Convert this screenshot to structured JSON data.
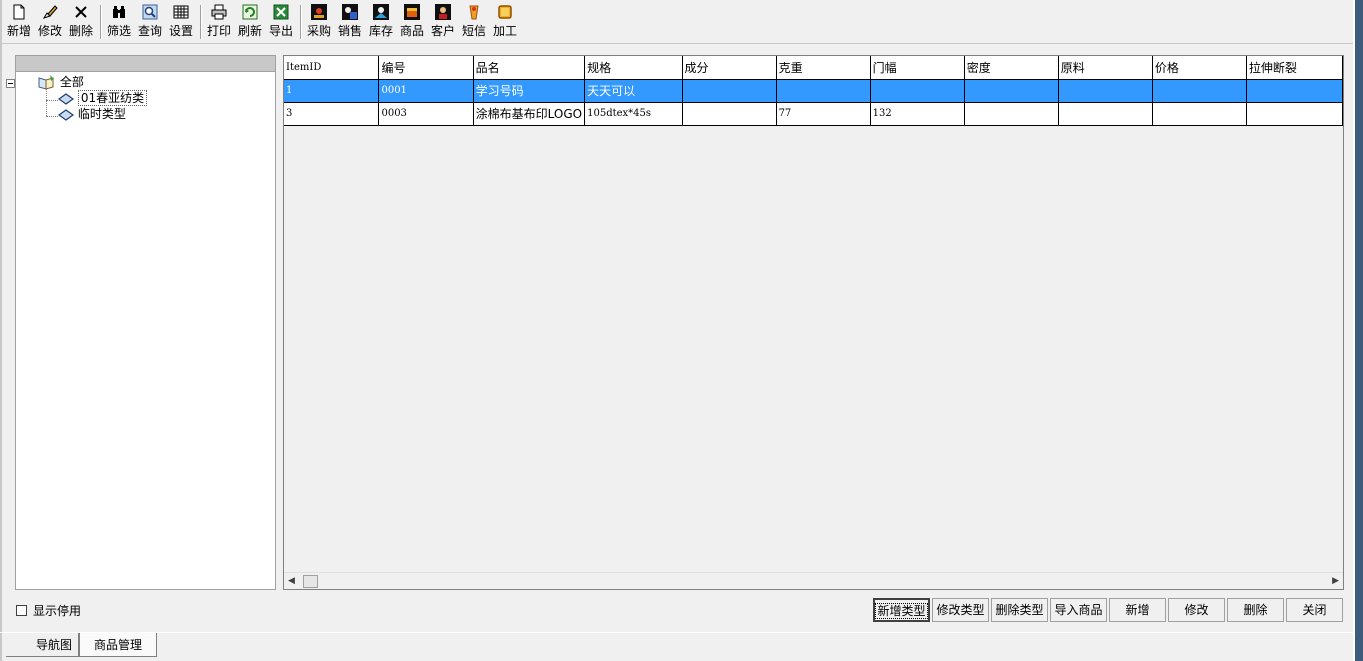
{
  "toolbar": {
    "groups": [
      [
        {
          "label": "新增",
          "icon": "new-doc-icon"
        },
        {
          "label": "修改",
          "icon": "edit-brush-icon"
        },
        {
          "label": "删除",
          "icon": "delete-x-icon"
        }
      ],
      [
        {
          "label": "筛选",
          "icon": "binoculars-icon"
        },
        {
          "label": "查询",
          "icon": "search-query-icon"
        },
        {
          "label": "设置",
          "icon": "settings-grid-icon"
        }
      ],
      [
        {
          "label": "打印",
          "icon": "printer-icon"
        },
        {
          "label": "刷新",
          "icon": "refresh-icon"
        },
        {
          "label": "导出",
          "icon": "export-excel-icon"
        }
      ],
      [
        {
          "label": "采购",
          "icon": "purchase-icon"
        },
        {
          "label": "销售",
          "icon": "sales-icon"
        },
        {
          "label": "库存",
          "icon": "inventory-icon"
        },
        {
          "label": "商品",
          "icon": "goods-icon"
        },
        {
          "label": "客户",
          "icon": "customer-icon"
        },
        {
          "label": "短信",
          "icon": "sms-icon"
        },
        {
          "label": "加工",
          "icon": "processing-icon"
        }
      ]
    ]
  },
  "tree": {
    "root": "全部",
    "children": [
      "01春亚纺类",
      "临时类型"
    ],
    "selected_index": 0
  },
  "grid": {
    "columns": [
      "ItemID",
      "编号",
      "品名",
      "规格",
      "成分",
      "克重",
      "门幅",
      "密度",
      "原料",
      "价格",
      "拉伸断裂"
    ],
    "rows": [
      [
        "1",
        "0001",
        "学习号码",
        "天天可以",
        "",
        "",
        "",
        "",
        "",
        "",
        ""
      ],
      [
        "3",
        "0003",
        "涂棉布基布印LOGO",
        "105dtex*45s",
        "",
        "77",
        "132",
        "",
        "",
        "",
        ""
      ]
    ],
    "selected_row": 0
  },
  "show_disabled_label": "显示停用",
  "buttons": [
    "新增类型",
    "修改类型",
    "删除类型",
    "导入商品",
    "新增",
    "修改",
    "删除",
    "关闭"
  ],
  "tabs": [
    "导航图",
    "商品管理"
  ],
  "colors": {
    "selection": "#3399ff",
    "window_border": "#3d5b7a"
  }
}
